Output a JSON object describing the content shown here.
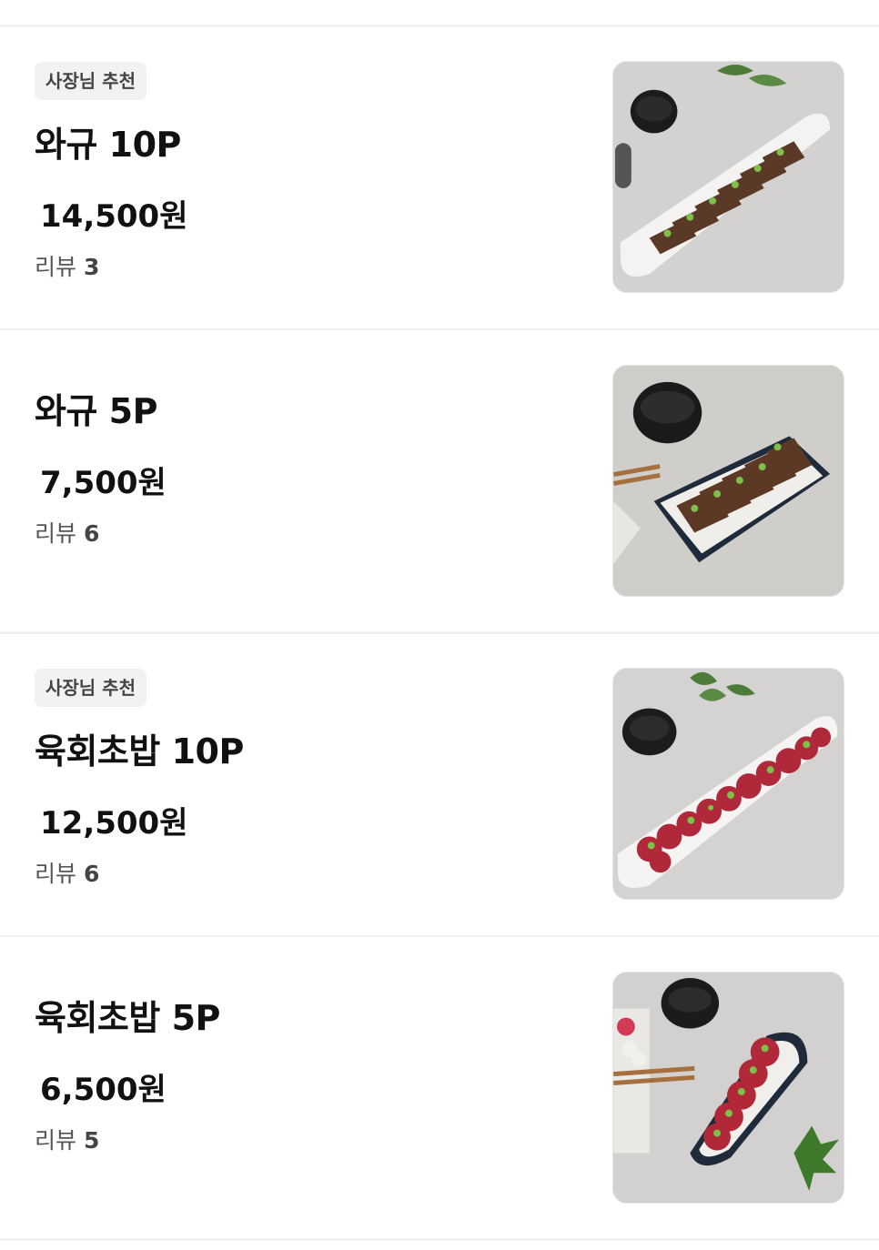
{
  "items": [
    {
      "badge": "사장님 추천",
      "name": "와규 10P",
      "price": "14,500원",
      "review_label": "리뷰",
      "review_count": "3",
      "image": "wagyu-10p-photo"
    },
    {
      "badge": "",
      "name": "와규 5P",
      "price": "7,500원",
      "review_label": "리뷰",
      "review_count": "6",
      "image": "wagyu-5p-photo"
    },
    {
      "badge": "사장님 추천",
      "name": "육회초밥 10P",
      "price": "12,500원",
      "review_label": "리뷰",
      "review_count": "6",
      "image": "yukhoe-sushi-10p-photo"
    },
    {
      "badge": "",
      "name": "육회초밥 5P",
      "price": "6,500원",
      "review_label": "리뷰",
      "review_count": "5",
      "image": "yukhoe-sushi-5p-photo"
    }
  ]
}
